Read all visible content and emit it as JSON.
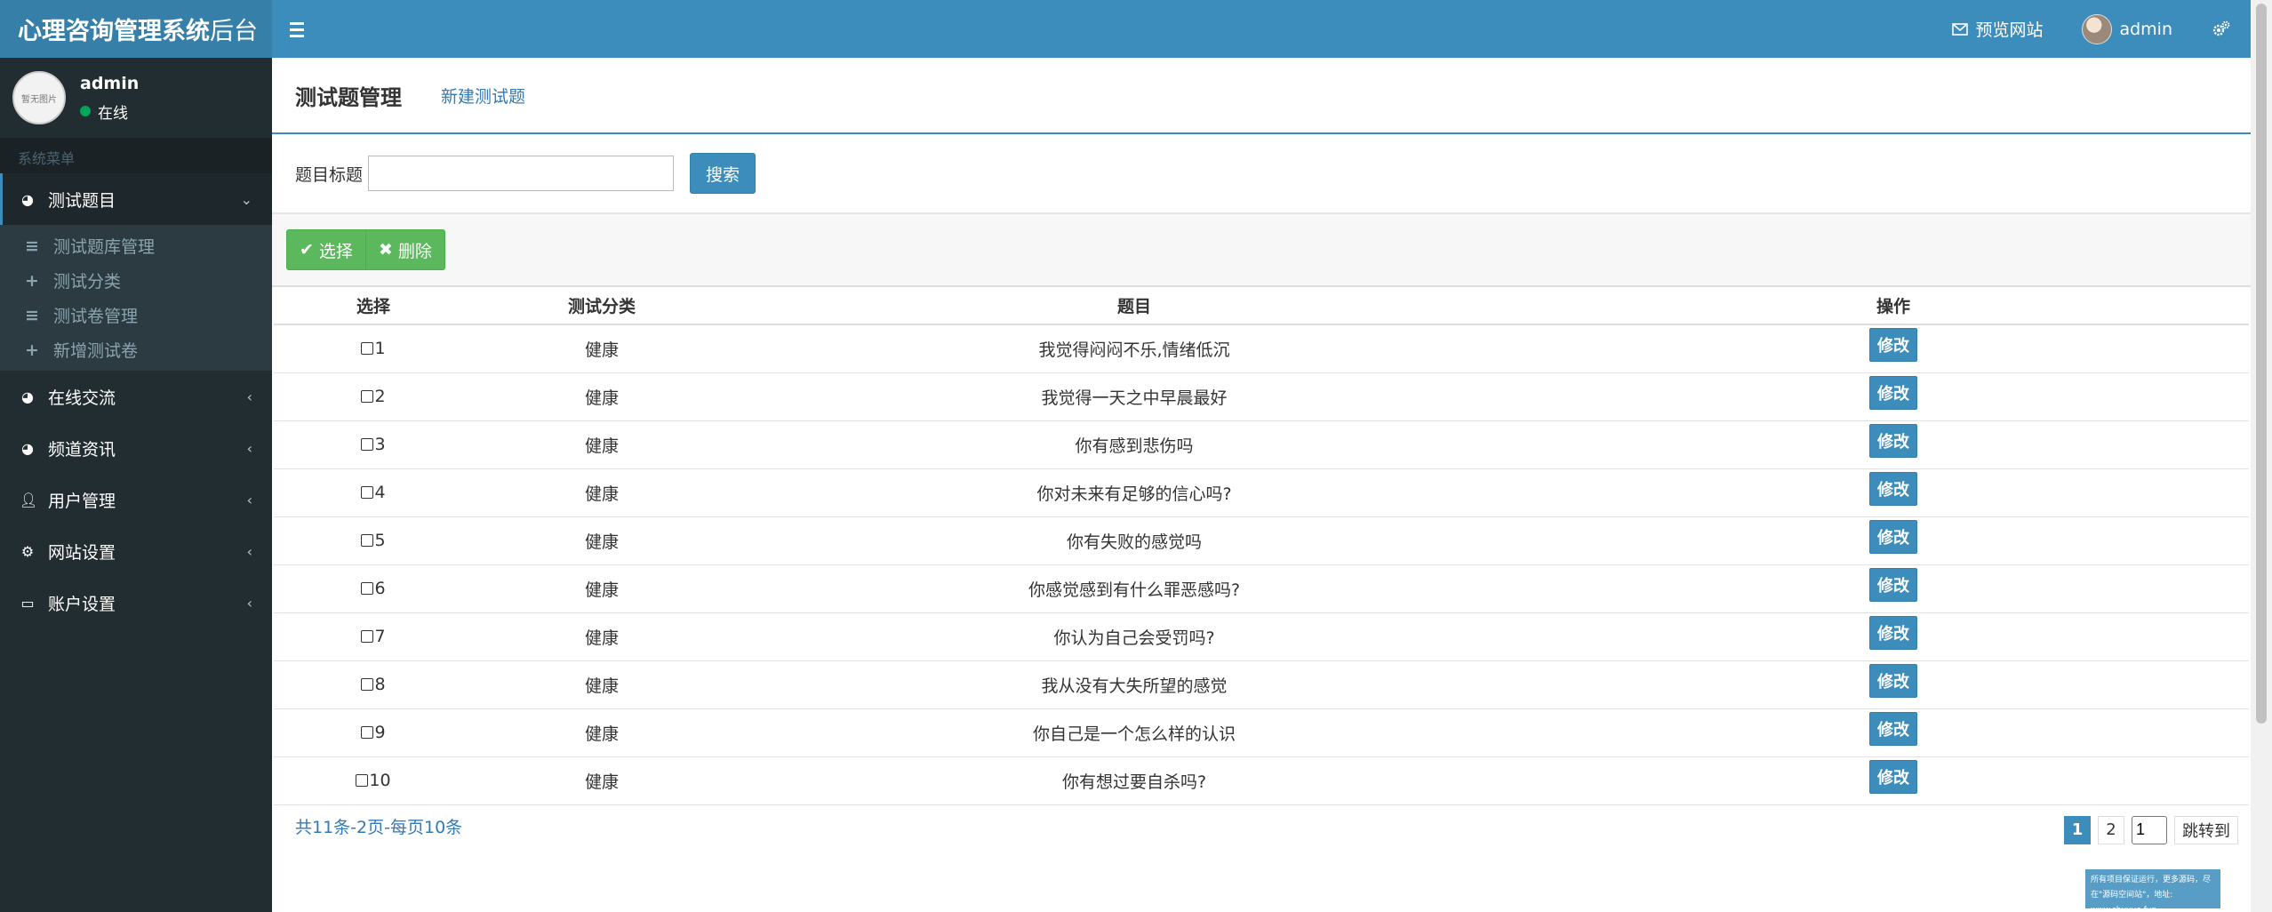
{
  "header": {
    "logo_bold": "心理咨询管理系统",
    "logo_light": "后台",
    "preview_label": "预览网站",
    "user_label": "admin"
  },
  "sidebar": {
    "user_name": "admin",
    "user_status": "在线",
    "avatar_text": "暂无图片",
    "menu_header": "系统菜单",
    "items": [
      {
        "label": "测试题目"
      },
      {
        "label": "在线交流"
      },
      {
        "label": "频道资讯"
      },
      {
        "label": "用户管理"
      },
      {
        "label": "网站设置"
      },
      {
        "label": "账户设置"
      }
    ],
    "subitems": [
      {
        "label": "测试题库管理",
        "icon": "≡"
      },
      {
        "label": "测试分类",
        "icon": "+"
      },
      {
        "label": "测试卷管理",
        "icon": "≡"
      },
      {
        "label": "新增测试卷",
        "icon": "+"
      }
    ]
  },
  "main": {
    "title": "测试题管理",
    "new_link": "新建测试题",
    "search_label": "题目标题",
    "search_value": "",
    "search_button": "搜索",
    "select_button": "选择",
    "delete_button": "删除",
    "columns": [
      "选择",
      "测试分类",
      "题目",
      "操作"
    ],
    "edit_label": "修改",
    "rows": [
      {
        "id": "1",
        "category": "健康",
        "title": "我觉得闷闷不乐,情绪低沉"
      },
      {
        "id": "2",
        "category": "健康",
        "title": "我觉得一天之中早晨最好"
      },
      {
        "id": "3",
        "category": "健康",
        "title": "你有感到悲伤吗"
      },
      {
        "id": "4",
        "category": "健康",
        "title": "你对未来有足够的信心吗?"
      },
      {
        "id": "5",
        "category": "健康",
        "title": "你有失败的感觉吗"
      },
      {
        "id": "6",
        "category": "健康",
        "title": "你感觉感到有什么罪恶感吗?"
      },
      {
        "id": "7",
        "category": "健康",
        "title": "你认为自己会受罚吗?"
      },
      {
        "id": "8",
        "category": "健康",
        "title": "我从没有大失所望的感觉"
      },
      {
        "id": "9",
        "category": "健康",
        "title": "你自己是一个怎么样的认识"
      },
      {
        "id": "10",
        "category": "健康",
        "title": "你有想过要自杀吗?"
      }
    ],
    "total_text": "共11条-2页-每页10条",
    "pages": [
      "1",
      "2"
    ],
    "page_input": "1",
    "jump_label": "跳转到"
  },
  "watermark": {
    "line1": "所有项目保证运行，更多源码，尽在\"源码空间站\"，地址: www.shuyue.fun"
  }
}
